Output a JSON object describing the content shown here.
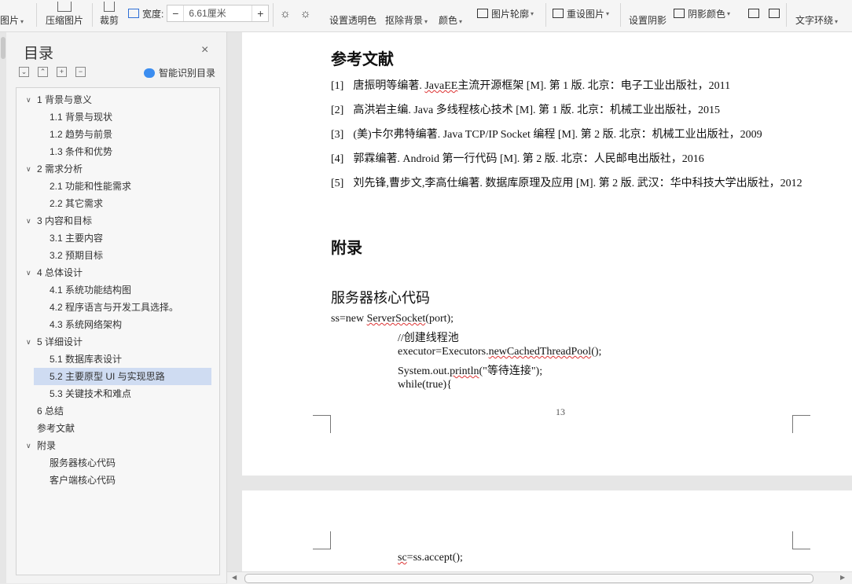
{
  "toolbar": {
    "image_label": "图片",
    "compress_label": "压缩图片",
    "crop_label": "裁剪",
    "width_label": "宽度:",
    "width_value": "6.61厘米",
    "minus": "−",
    "plus": "+",
    "transparent_label": "设置透明色",
    "remove_bg_label": "抠除背景",
    "color_label": "颜色",
    "outline_label": "图片轮廓",
    "reset_label": "重设图片",
    "shadow_label": "设置阴影",
    "shadow_color_label": "阴影颜色",
    "wrap_label": "文字环绕"
  },
  "toc": {
    "title": "目录",
    "close": "×",
    "smart_label": "智能识别目录",
    "items": [
      {
        "label": "1  背景与意义",
        "level": 1,
        "expanded": true
      },
      {
        "label": "1.1  背景与现状",
        "level": 2
      },
      {
        "label": "1.2  趋势与前景",
        "level": 2
      },
      {
        "label": "1.3  条件和优势",
        "level": 2
      },
      {
        "label": "2  需求分析",
        "level": 1,
        "expanded": true
      },
      {
        "label": "2.1  功能和性能需求",
        "level": 2
      },
      {
        "label": "2.2  其它需求",
        "level": 2
      },
      {
        "label": "3  内容和目标",
        "level": 1,
        "expanded": true
      },
      {
        "label": "3.1    主要内容",
        "level": 2
      },
      {
        "label": "3.2    预期目标",
        "level": 2
      },
      {
        "label": "4  总体设计",
        "level": 1,
        "expanded": true
      },
      {
        "label": "4.1 系统功能结构图",
        "level": 2
      },
      {
        "label": "4.2  程序语言与开发工具选择。",
        "level": 2
      },
      {
        "label": "4.3  系统网络架构",
        "level": 2
      },
      {
        "label": "5  详细设计",
        "level": 1,
        "expanded": true
      },
      {
        "label": "5.1  数据库表设计",
        "level": 2
      },
      {
        "label": "5.2  主要原型 UI 与实现思路",
        "level": 2,
        "active": true
      },
      {
        "label": "5.3  关键技术和难点",
        "level": 2
      },
      {
        "label": "6  总结",
        "level": 1
      },
      {
        "label": "参考文献",
        "level": 1
      },
      {
        "label": "附录",
        "level": 1,
        "expanded": true
      },
      {
        "label": "服务器核心代码",
        "level": 2
      },
      {
        "label": "客户端核心代码",
        "level": 2
      }
    ]
  },
  "document": {
    "references_title": "参考文献",
    "references": [
      {
        "num": "[1]",
        "text_a": "唐振明等编著. ",
        "squig": "JavaEE",
        "text_b": "主流开源框架  [M]. 第 1 版. 北京：电子工业出版社，2011"
      },
      {
        "num": "[2]",
        "text_a": "高洪岩主编. Java 多线程核心技术  [M]. 第 1 版. 北京：机械工业出版社，2015",
        "squig": "",
        "text_b": ""
      },
      {
        "num": "[3]",
        "text_a": "(美)卡尔弗特编著. Java TCP/IP Socket 编程  [M]. 第 2 版. 北京：机械工业出版社，2009",
        "squig": "",
        "text_b": ""
      },
      {
        "num": "[4]",
        "text_a": "郭霖编著. Android 第一行代码  [M]. 第 2 版. 北京：人民邮电出版社，2016",
        "squig": "",
        "text_b": ""
      },
      {
        "num": "[5]",
        "text_a": "刘先锋,曹步文,李高仕编著. 数据库原理及应用  [M]. 第 2 版. 武汉：华中科技大学出版社，2012",
        "squig": "",
        "text_b": ""
      }
    ],
    "appendix_title": "附录",
    "server_code_title": "服务器核心代码",
    "code_lines": [
      {
        "a": "ss=new ",
        "s": "ServerSocket",
        "b": "(port);",
        "indent": 0
      },
      {
        "a": "//创建线程池",
        "s": "",
        "b": "",
        "indent": 1
      },
      {
        "a": "executor=Executors.",
        "s": "newCachedThreadPool",
        "b": "();",
        "indent": 1
      },
      {
        "a": "System.out.",
        "s": "println",
        "b": "(\"等待连接\");",
        "indent": 1
      },
      {
        "a": "while(true){",
        "s": "",
        "b": "",
        "indent": 1
      }
    ],
    "page_number": "13",
    "page2_code": {
      "a": "",
      "s": "sc",
      "b": "=ss.accept();"
    }
  }
}
